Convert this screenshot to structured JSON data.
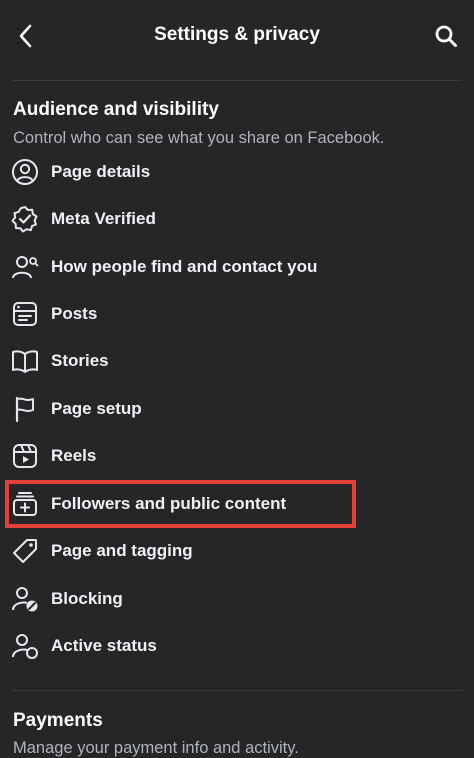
{
  "header": {
    "title": "Settings & privacy",
    "back_icon": "chevron-left-icon",
    "search_icon": "search-icon"
  },
  "audience": {
    "title": "Audience and visibility",
    "subtitle": "Control who can see what you share on Facebook.",
    "items": [
      {
        "label": "Page details",
        "icon": "person-circle-icon"
      },
      {
        "label": "Meta Verified",
        "icon": "verified-badge-icon"
      },
      {
        "label": "How people find and contact you",
        "icon": "person-search-icon"
      },
      {
        "label": "Posts",
        "icon": "posts-icon"
      },
      {
        "label": "Stories",
        "icon": "book-icon"
      },
      {
        "label": "Page setup",
        "icon": "flag-icon"
      },
      {
        "label": "Reels",
        "icon": "reels-icon"
      },
      {
        "label": "Followers and public content",
        "icon": "followers-add-icon",
        "highlighted": true
      },
      {
        "label": "Page and tagging",
        "icon": "tag-icon"
      },
      {
        "label": "Blocking",
        "icon": "person-block-icon"
      },
      {
        "label": "Active status",
        "icon": "person-status-icon"
      }
    ]
  },
  "payments": {
    "title": "Payments",
    "subtitle": "Manage your payment info and activity."
  },
  "colors": {
    "background": "#252628",
    "highlight_border": "#e5403a",
    "text_primary": "#ffffff",
    "text_secondary": "#b0b3b8"
  }
}
